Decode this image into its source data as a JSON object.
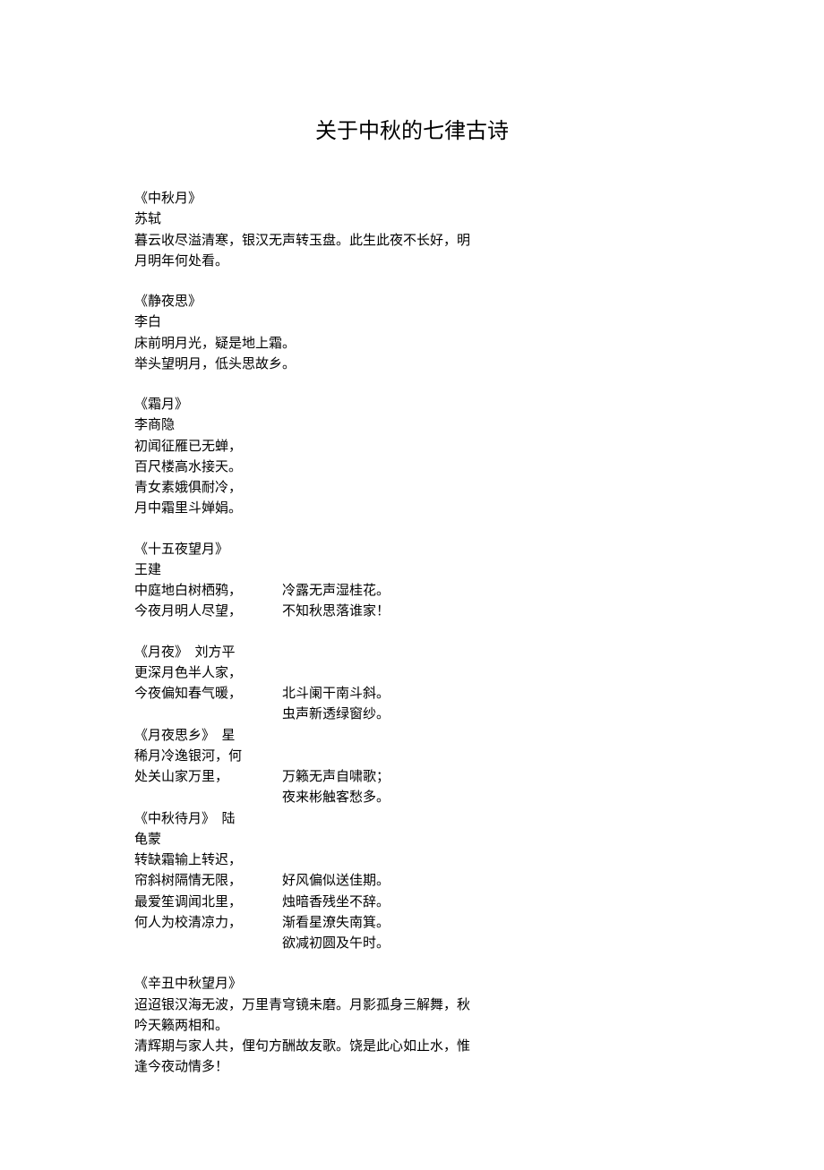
{
  "title": "关于中秋的七律古诗",
  "poems": [
    {
      "title": "《中秋月》",
      "author": "苏轼",
      "lines": [
        "暮云收尽溢清寒，银汉无声转玉盘。此生此夜不长好，明",
        "月明年何处看。"
      ]
    },
    {
      "title": "《静夜思》",
      "author": "李白",
      "lines": [
        "床前明月光，疑是地上霜。",
        "举头望明月，低头思故乡。"
      ]
    },
    {
      "title": "《霜月》",
      "author": "李商隐",
      "lines": [
        "初闻征雁已无蝉，",
        "百尺楼高水接天。",
        "青女素娥俱耐冷，",
        "月中霜里斗婵娟。"
      ]
    },
    {
      "title": "《十五夜望月》",
      "author": "王建",
      "left": [
        "中庭地白树栖鸦，",
        "今夜月明人尽望，"
      ],
      "right": [
        "冷露无声湿桂花。",
        "不知秋思落谁家！"
      ]
    },
    {
      "left": [
        "《月夜》　刘方平",
        "更深月色半人家，",
        "今夜偏知春气暖，",
        "",
        "《月夜思乡》　星",
        "稀月冷逸银河，何",
        "处关山家万里，",
        "",
        "《中秋待月》　陆",
        "龟蒙",
        "转缺霜输上转迟，",
        "帘斜树隔情无限，",
        "最爱笙调闻北里，",
        "何人为校清凉力，"
      ],
      "right": [
        "",
        "",
        "北斗阑干南斗斜。",
        "虫声新透绿窗纱。",
        "",
        "",
        "万籁无声自啸歌；",
        "夜来彬触客愁多。",
        "",
        "",
        "",
        "好风偏似送佳期。",
        "烛暗香残坐不辞。",
        "渐看星潦失南箕。",
        "欲减初圆及午时。"
      ]
    },
    {
      "title": "《辛丑中秋望月》",
      "lines": [
        "迢迢银汉海无波，万里青穹镜未磨。月影孤身三解舞，秋",
        "吟天籁两相和。",
        "清辉期与家人共，俚句方酬故友歌。饶是此心如止水，惟",
        "逢今夜动情多！"
      ]
    }
  ]
}
